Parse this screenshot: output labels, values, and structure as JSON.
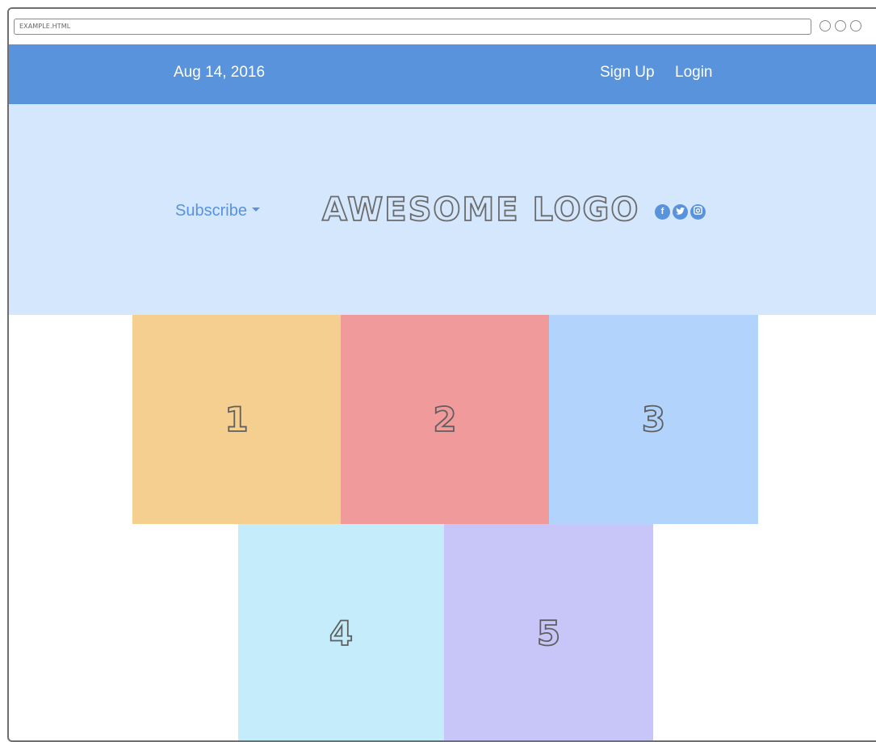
{
  "browser": {
    "address": "EXAMPLE.HTML"
  },
  "header": {
    "date": "Aug 14, 2016",
    "signup_label": "Sign Up",
    "login_label": "Login"
  },
  "hero": {
    "subscribe_label": "Subscribe",
    "logo_text": "AWESOME LOGO",
    "social_icons": [
      "facebook-icon",
      "twitter-icon",
      "instagram-icon"
    ]
  },
  "tiles": [
    {
      "label": "1",
      "color": "#f4cf8f"
    },
    {
      "label": "2",
      "color": "#f09a9c"
    },
    {
      "label": "3",
      "color": "#b2d4fc"
    },
    {
      "label": "4",
      "color": "#c4ecfa"
    },
    {
      "label": "5",
      "color": "#c8c6f8"
    }
  ],
  "colors": {
    "topbar": "#5893db",
    "hero_bg": "#d5e7fd",
    "accent": "#5893db"
  }
}
